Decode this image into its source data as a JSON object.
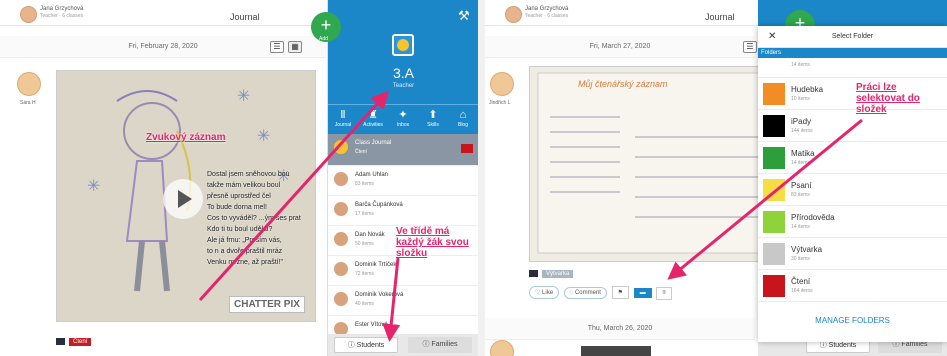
{
  "left": {
    "user_name": "Jana Grzychová",
    "user_role": "Teacher · 6 classes",
    "title": "Journal",
    "date": "Fri, February 28, 2020",
    "student_name": "Sára H",
    "tag": "Čtení",
    "add_label": "Add",
    "class_panel": {
      "class_name": "3.A",
      "role": "Teacher",
      "tabs": [
        {
          "icon": "Ⅱ",
          "label": "Journal"
        },
        {
          "icon": "♜",
          "label": "Activities"
        },
        {
          "icon": "✦",
          "label": "Inbox"
        },
        {
          "icon": "⬆",
          "label": "Skills"
        },
        {
          "icon": "⌂",
          "label": "Blog"
        }
      ],
      "rows": [
        {
          "name": "Class Journal",
          "count": "Čtení"
        },
        {
          "name": "Adam Uhlan",
          "count": "83 items"
        },
        {
          "name": "Barča Čupánková",
          "count": "17 items"
        },
        {
          "name": "Dan Novák",
          "count": "50 items"
        },
        {
          "name": "Dominik Trtíček",
          "count": "72 items"
        },
        {
          "name": "Dominik Vokerová",
          "count": "40 items"
        },
        {
          "name": "Ester Vítová",
          "count": ""
        }
      ],
      "students_label": "ⓘ Students",
      "families_label": "ⓘ Families"
    },
    "annotations": {
      "audio": "Zvukový záznam",
      "folder": "Ve třídě má každý žák svou složku"
    }
  },
  "right": {
    "user_name": "Jana Grzychová",
    "user_role": "Teacher · 6 classes",
    "title": "Journal",
    "date": "Fri, March 27, 2020",
    "student_name": "Jindřich L",
    "photo_text": "Můj čtenářský záznam",
    "tag": "Výtvarka",
    "like_label": "Like",
    "comment_label": "Comment",
    "date2": "Thu, March 26, 2020",
    "students_label": "ⓘ Students",
    "families_label": "ⓘ Families",
    "annotation": "Práci lze selektovat do složek",
    "popup": {
      "title": "Select Folder",
      "section": "Folders",
      "folders": [
        {
          "name": "",
          "count": "14 items",
          "color": "#ffffff"
        },
        {
          "name": "Hudebka",
          "count": "10 items",
          "color": "#f28c25"
        },
        {
          "name": "iPady",
          "count": "144 items",
          "color": "#000000"
        },
        {
          "name": "Matika",
          "count": "14 items",
          "color": "#2e9d3b"
        },
        {
          "name": "Psaní",
          "count": "83 items",
          "color": "#f5de45"
        },
        {
          "name": "Přírodověda",
          "count": "14 items",
          "color": "#8ed33a"
        },
        {
          "name": "Výtvarka",
          "count": "30 items",
          "color": "#c8c8c8"
        },
        {
          "name": "Čtení",
          "count": "164 items",
          "color": "#c8151b"
        }
      ],
      "manage_label": "MANAGE FOLDERS"
    }
  },
  "colors": {
    "accent": "#1b87c9",
    "annotation": "#e6246c",
    "fab": "#2fa84f"
  }
}
